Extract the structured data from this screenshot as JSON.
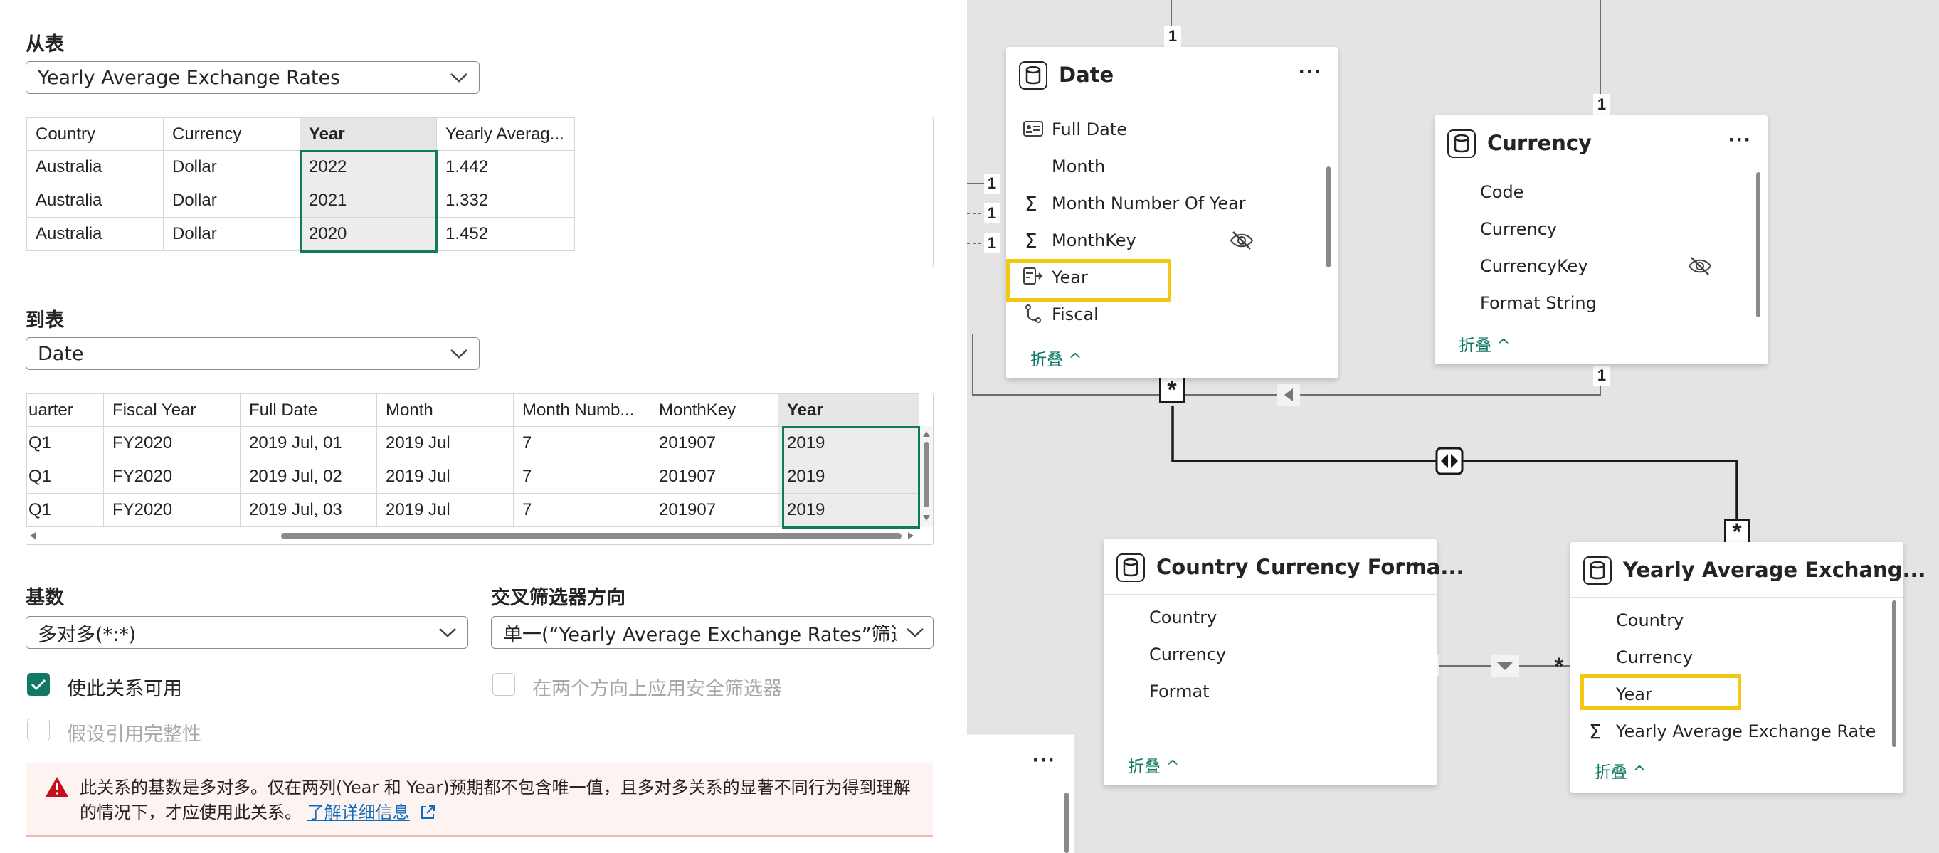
{
  "from_table": {
    "label": "从表",
    "selected": "Yearly Average Exchange Rates",
    "columns": [
      "Country",
      "Currency",
      "Year",
      "Yearly Averag..."
    ],
    "rows": [
      [
        "Australia",
        "Dollar",
        "2022",
        "1.442"
      ],
      [
        "Australia",
        "Dollar",
        "2021",
        "1.332"
      ],
      [
        "Australia",
        "Dollar",
        "2020",
        "1.452"
      ]
    ]
  },
  "to_table": {
    "label": "到表",
    "selected": "Date",
    "columns": [
      "uarter",
      "Fiscal Year",
      "Full Date",
      "Month",
      "Month Numb...",
      "MonthKey",
      "Year"
    ],
    "rows": [
      [
        "Q1",
        "FY2020",
        "2019 Jul, 01",
        "2019 Jul",
        "7",
        "201907",
        "2019"
      ],
      [
        "Q1",
        "FY2020",
        "2019 Jul, 02",
        "2019 Jul",
        "7",
        "201907",
        "2019"
      ],
      [
        "Q1",
        "FY2020",
        "2019 Jul, 03",
        "2019 Jul",
        "7",
        "201907",
        "2019"
      ]
    ]
  },
  "cardinality": {
    "label": "基数",
    "selected": "多对多(*:*)"
  },
  "cross_filter": {
    "label": "交叉筛选器方向",
    "selected": "单一(“Yearly Average Exchange Rates”筛选“D"
  },
  "options": {
    "active_label": "使此关系可用",
    "active_checked": true,
    "security_label": "在两个方向上应用安全筛选器",
    "security_checked": false,
    "integrity_label": "假设引用完整性",
    "integrity_checked": false
  },
  "warning": {
    "text": "此关系的基数是多对多。仅在两列(Year 和 Year)预期都不包含唯一值，且多对多关系的显著不同行为得到理解的情况下，才应使用此关系。",
    "link": "了解详细信息"
  },
  "canvas": {
    "more_label": "···",
    "date_card": {
      "title": "Date",
      "fields": [
        "Full Date",
        "Month",
        "Month Number Of Year",
        "MonthKey",
        "Year",
        "Fiscal"
      ],
      "collapse": "折叠"
    },
    "currency_card": {
      "title": "Currency",
      "fields": [
        "Code",
        "Currency",
        "CurrencyKey",
        "Format String"
      ],
      "collapse": "折叠"
    },
    "ccf_card": {
      "title": "Country Currency Forma...",
      "fields": [
        "Country",
        "Currency",
        "Format"
      ],
      "collapse": "折叠"
    },
    "yaer_card": {
      "title": "Yearly Average Exchang...",
      "fields": [
        "Country",
        "Currency",
        "Year",
        "Yearly Average Exchange Rate"
      ],
      "collapse": "折叠"
    },
    "cardinality_one": "1",
    "cardinality_many": "*"
  },
  "colors": {
    "accent": "#117865",
    "highlight": "#f2c811",
    "link": "#0f6cbd",
    "canvas_bg": "#e4e4e4"
  }
}
